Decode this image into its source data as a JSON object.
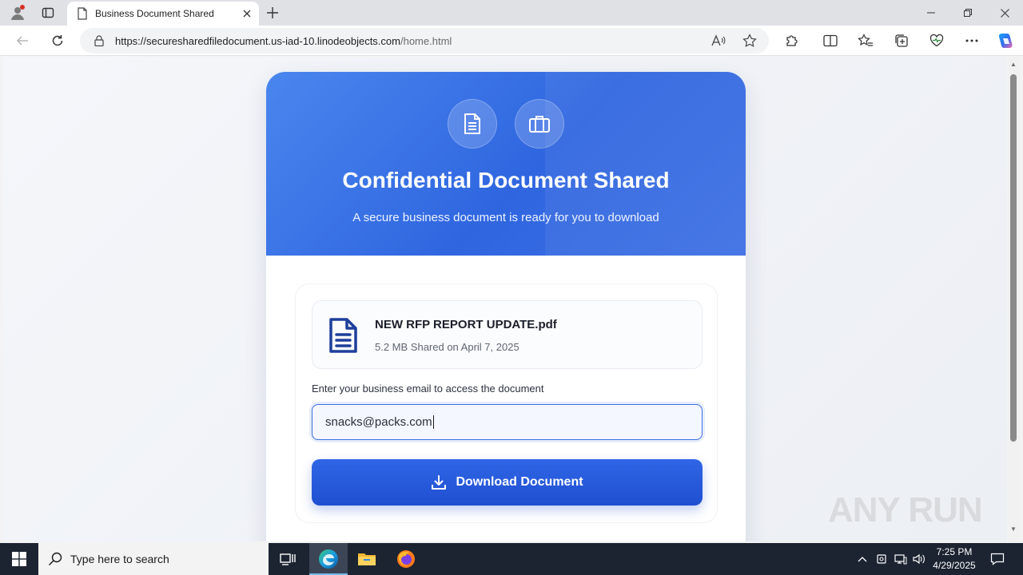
{
  "browser": {
    "tab_title": "Business Document Shared",
    "url_host": "https://securesharedfiledocument.us-iad-10.linodeobjects.com",
    "url_path": "/home.html"
  },
  "page": {
    "title": "Confidential Document Shared",
    "subtitle": "A secure business document is ready for you to download",
    "file_name": "NEW RFP REPORT UPDATE.pdf",
    "file_meta": "5.2 MB Shared on April 7, 2025",
    "email_label": "Enter your business email to access the document",
    "email_value": "snacks@packs.com",
    "download_label": "Download Document",
    "accent": "#2f66e6"
  },
  "watermark": "ANY RUN",
  "taskbar": {
    "search_placeholder": "Type here to search",
    "time": "7:25 PM",
    "date": "4/29/2025"
  }
}
